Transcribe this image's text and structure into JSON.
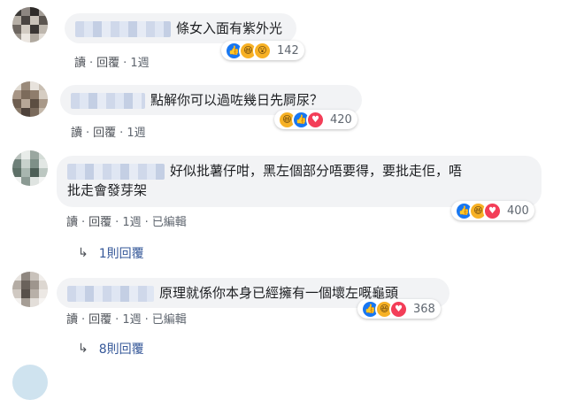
{
  "comments": [
    {
      "text": "條女入面有紫外光",
      "reactions_count": "142",
      "reactions": [
        "like-icon",
        "haha-icon",
        "wow-icon"
      ],
      "meta": {
        "read": "讀",
        "reply": "回覆",
        "time": "1週",
        "edited": ""
      }
    },
    {
      "text": "點解你可以過咗幾日先屙尿？",
      "reactions_count": "420",
      "reactions": [
        "haha-icon",
        "like-icon",
        "love-icon"
      ],
      "meta": {
        "read": "讀",
        "reply": "回覆",
        "time": "1週",
        "edited": ""
      }
    },
    {
      "text_line1": "好似批薯仔咁，黑左個部分唔要得，要批走佢，唔",
      "text_line2": "批走會發芽架",
      "reactions_count": "400",
      "reactions": [
        "like-icon",
        "haha-icon",
        "love-icon"
      ],
      "meta": {
        "read": "讀",
        "reply": "回覆",
        "time": "1週",
        "edited": "已編輯"
      },
      "replies_label": "1則回覆"
    },
    {
      "text": "原理就係你本身已經擁有一個壞左嘅龜頭",
      "reactions_count": "368",
      "reactions": [
        "like-icon",
        "haha-icon",
        "love-icon"
      ],
      "meta": {
        "read": "讀",
        "reply": "回覆",
        "time": "1週",
        "edited": "已編輯"
      },
      "replies_label": "8則回覆"
    }
  ],
  "colors": {
    "link": "#365899",
    "bubble": "#f2f3f5",
    "like": "#1877f2",
    "love": "#f33e58",
    "haha": "#f7b125"
  }
}
